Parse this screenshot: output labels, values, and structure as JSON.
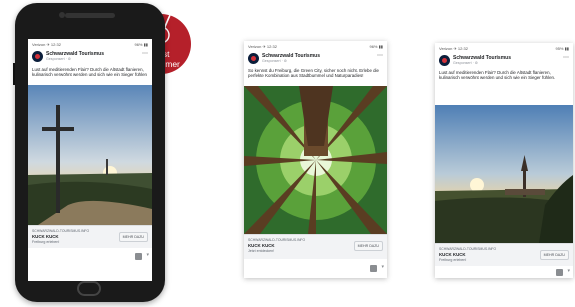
{
  "badge": {
    "number": "1",
    "line1": "Best",
    "line2": "Performer",
    "color": "#b5202a"
  },
  "ads": [
    {
      "status": {
        "left": "Verizon ✈ 12:32",
        "right": "96% ▮▮"
      },
      "page_name": "Schwarzwald Tourismus",
      "sponsored": "Gesponsert · ⚙",
      "caption": "Lust auf meditierenden Flair? Durch die Altstadt flanieren, kulinarisch verwöhnt werden und sich wie ein Sieger fühlen",
      "cta": {
        "domain": "SCHWARZWALD-TOURISMUS.INFO",
        "title": "KUCK KUCK",
        "desc": "Freiburg erleben!",
        "button": "MEHR DAZU"
      }
    },
    {
      "status": {
        "left": "Verizon ✈ 12:32",
        "right": "96% ▮▮"
      },
      "page_name": "Schwarzwald Tourismus",
      "sponsored": "Gesponsert · ⚙",
      "caption": "So kennst du Freiburg, die Green City, sicher noch nicht. Erlebe die perfekte Kombination aus Stadtbummel und Naturparadies!",
      "cta": {
        "domain": "SCHWARZWALD-TOURISMUS.INFO",
        "title": "KUCK KUCK",
        "desc": "Jetzt entdecken!",
        "button": "MEHR DAZU"
      }
    },
    {
      "status": {
        "left": "Verizon ✈ 12:32",
        "right": "95% ▮▮"
      },
      "page_name": "Schwarzwald Tourismus",
      "sponsored": "Gesponsert · ⚙",
      "caption": "Lust auf meditierenden Flair? Durch die Altstadt flanieren, kulinarisch verwöhnt werden und sich wie ein Sieger fühlen.",
      "cta": {
        "domain": "SCHWARZWALD-TOURISMUS.INFO",
        "title": "KUCK KUCK",
        "desc": "Freiburg erleben!",
        "button": "MEHR DAZU"
      }
    }
  ]
}
